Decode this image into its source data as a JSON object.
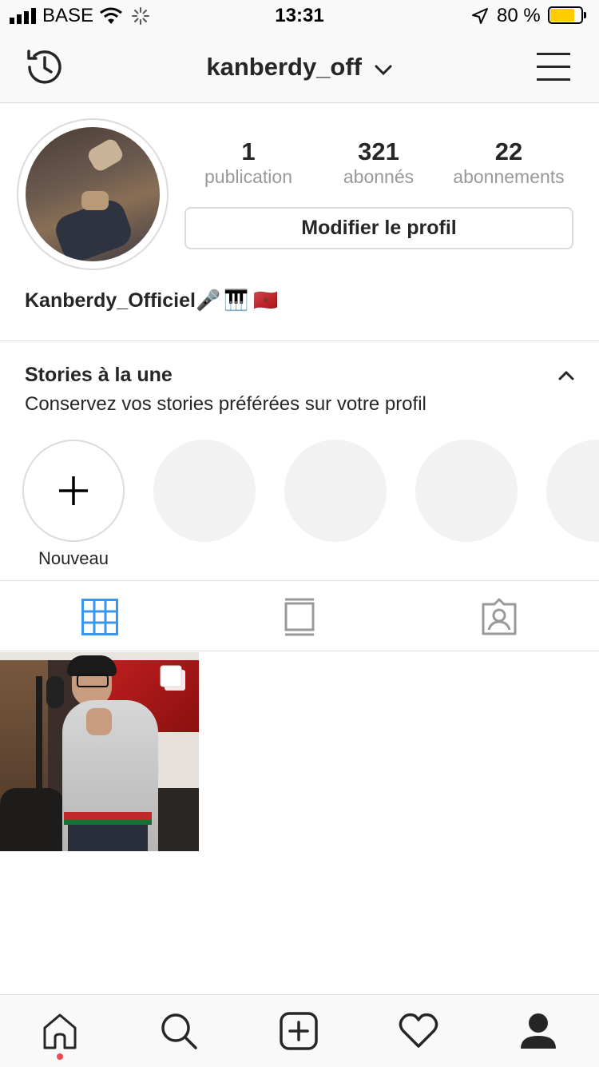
{
  "status_bar": {
    "carrier": "BASE",
    "time": "13:31",
    "battery_percent": "80 %",
    "battery_level": 0.8,
    "battery_color": "#ffcc00"
  },
  "nav": {
    "username": "kanberdy_off",
    "icons": [
      "history-icon",
      "chevron-down-icon",
      "menu-icon"
    ]
  },
  "profile": {
    "stats": [
      {
        "value": "1",
        "label": "publication"
      },
      {
        "value": "321",
        "label": "abonnés"
      },
      {
        "value": "22",
        "label": "abonnements"
      }
    ],
    "edit_button": "Modifier le profil",
    "display_name": "Kanberdy_Officiel",
    "bio_emojis": [
      "🎤",
      "🎹",
      "🇲🇦"
    ]
  },
  "highlights": {
    "title": "Stories à la une",
    "subtitle": "Conservez vos stories préférées sur votre profil",
    "new_label": "Nouveau"
  },
  "tabs": [
    "grid-icon",
    "feed-icon",
    "tagged-icon"
  ],
  "colors": {
    "accent": "#3897f0",
    "text": "#262626",
    "muted": "#999999",
    "border": "#dbdbdb",
    "notification_dot": "#ed4956"
  },
  "bottom_nav": [
    "home-icon",
    "search-icon",
    "add-icon",
    "heart-icon",
    "profile-icon"
  ]
}
